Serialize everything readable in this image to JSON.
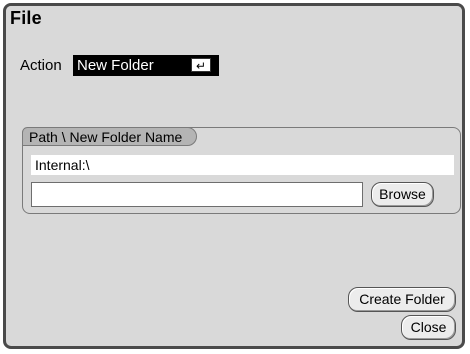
{
  "dialog": {
    "title": "File"
  },
  "action": {
    "label": "Action",
    "selected": "New Folder",
    "enter_glyph": "↵"
  },
  "path_group": {
    "legend": "Path \\ New Folder Name",
    "current_path": "Internal:\\",
    "name_value": ""
  },
  "buttons": {
    "browse": "Browse",
    "create_folder": "Create Folder",
    "close": "Close"
  }
}
